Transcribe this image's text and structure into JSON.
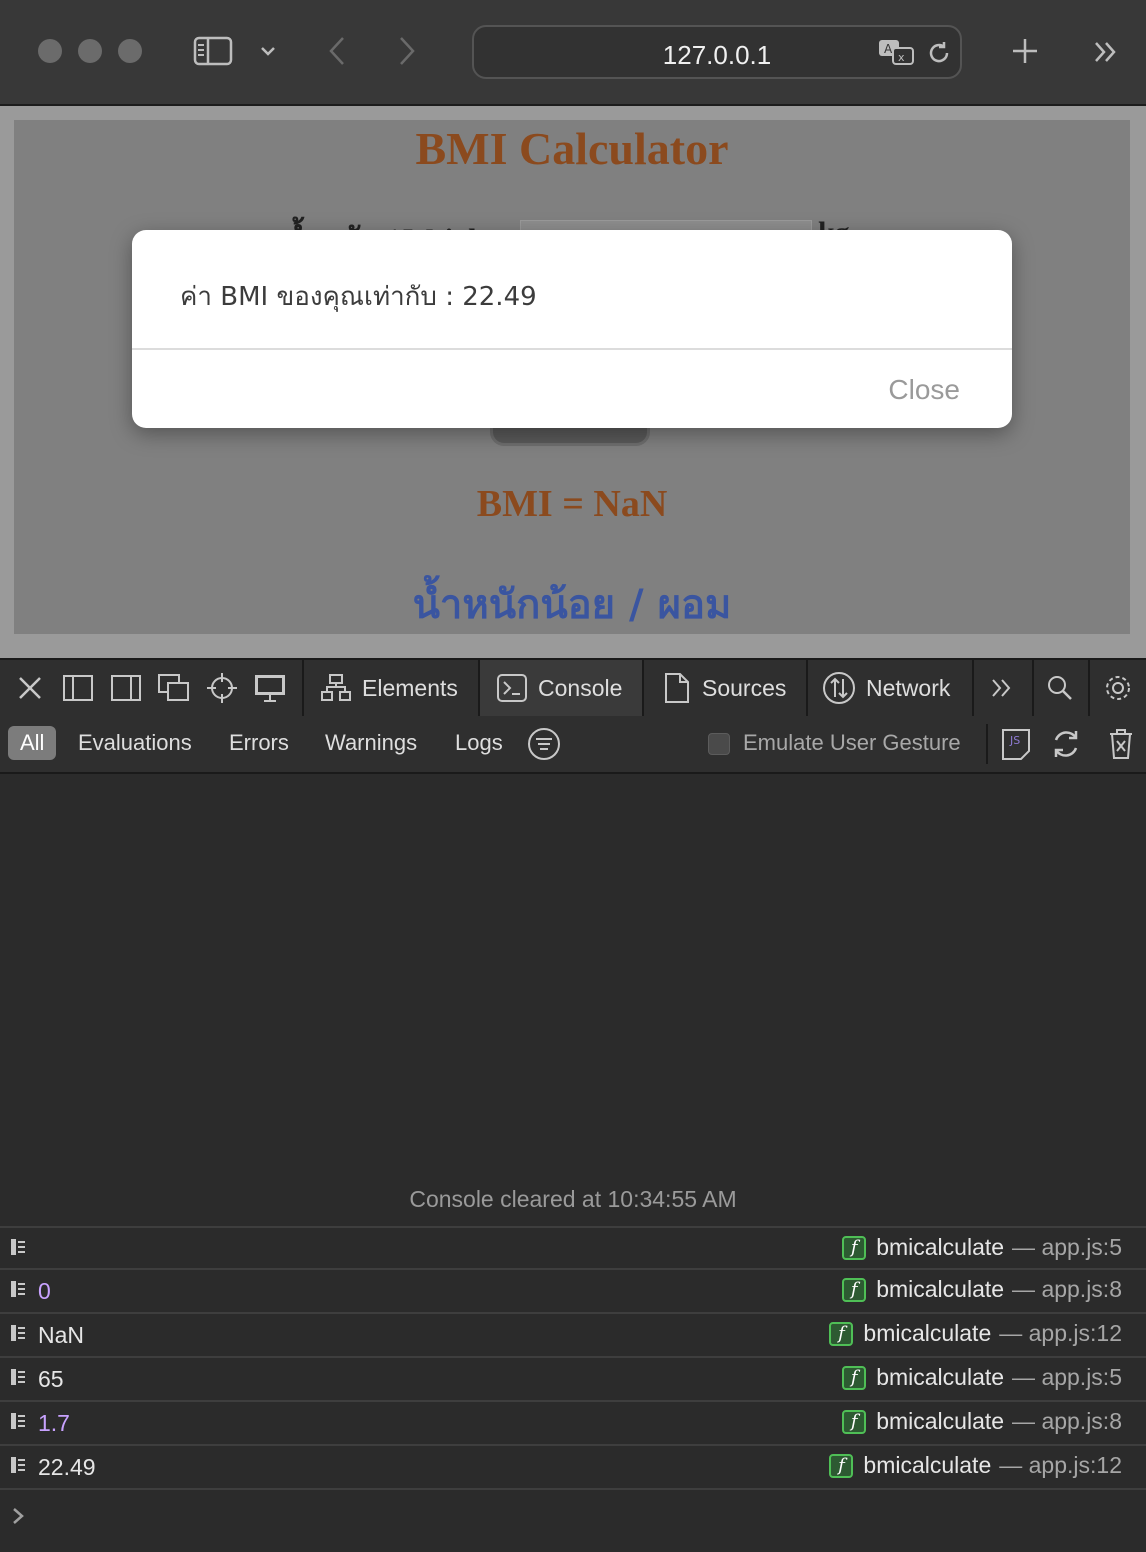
{
  "browser": {
    "url": "127.0.0.1"
  },
  "page": {
    "title": "BMI Calculator",
    "weight_label": "น้ำหนัก / Weight",
    "weight_unit": "kg",
    "bmi_result": "BMI = NaN",
    "bmi_category": "น้ำหนักน้อย / ผอม"
  },
  "dialog": {
    "message": "ค่า BMI ของคุณเท่ากับ : 22.49",
    "close_label": "Close"
  },
  "devtools": {
    "tabs": [
      {
        "label": "Elements"
      },
      {
        "label": "Console"
      },
      {
        "label": "Sources"
      },
      {
        "label": "Network"
      }
    ],
    "active_tab": "Console",
    "filters": [
      "All",
      "Evaluations",
      "Errors",
      "Warnings",
      "Logs"
    ],
    "active_filter": "All",
    "emulate_label": "Emulate User Gesture"
  },
  "console": {
    "cleared_message": "Console cleared at 10:34:55 AM",
    "logs": [
      {
        "value": "",
        "func": "bmicalculate",
        "file": "app.js:5"
      },
      {
        "value": "0",
        "func": "bmicalculate",
        "file": "app.js:8"
      },
      {
        "value": "NaN",
        "func": "bmicalculate",
        "file": "app.js:12"
      },
      {
        "value": "65",
        "func": "bmicalculate",
        "file": "app.js:5"
      },
      {
        "value": "1.7",
        "func": "bmicalculate",
        "file": "app.js:8"
      },
      {
        "value": "22.49",
        "func": "bmicalculate",
        "file": "app.js:12"
      }
    ]
  },
  "colors": {
    "title": "#8b4a1e",
    "category": "#3a55a0",
    "number_log": "#c8a2ff",
    "func_badge": "#4fbf56"
  }
}
